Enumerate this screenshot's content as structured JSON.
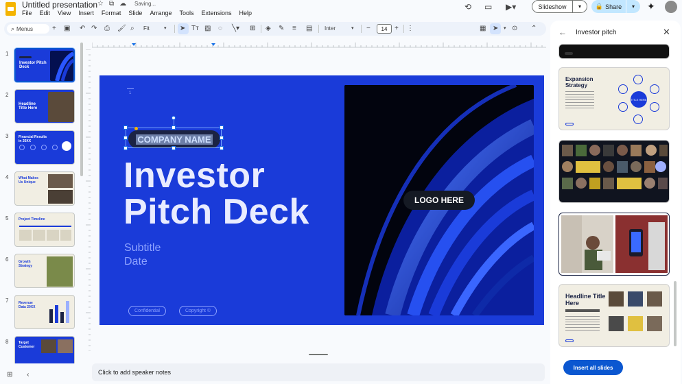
{
  "app": {
    "title": "Untitled presentation",
    "saving_status": "Saving...",
    "title_icons": [
      "☆",
      "⧉",
      "☁"
    ],
    "menu": [
      "File",
      "Edit",
      "View",
      "Insert",
      "Format",
      "Slide",
      "Arrange",
      "Tools",
      "Extensions",
      "Help"
    ]
  },
  "header": {
    "slideshow_label": "Slideshow",
    "share_label": "Share"
  },
  "toolbar": {
    "menus_label": "Menus",
    "zoom_label": "Fit",
    "font_label": "Inter",
    "font_size": "14"
  },
  "filmstrip": [
    {
      "num": "1",
      "title": "Investor Pitch Deck",
      "style": "blue"
    },
    {
      "num": "2",
      "title": "Headline Title Here",
      "style": "blue"
    },
    {
      "num": "3",
      "title": "Financial Results in 20XX",
      "style": "blue"
    },
    {
      "num": "4",
      "title": "What Makes Us Unique",
      "style": "cream"
    },
    {
      "num": "5",
      "title": "Project Timeline",
      "style": "cream"
    },
    {
      "num": "6",
      "title": "Growth Strategy",
      "style": "cream"
    },
    {
      "num": "7",
      "title": "Revenue Data 20XX",
      "style": "cream"
    },
    {
      "num": "8",
      "title": "Target Customer",
      "style": "blue"
    }
  ],
  "slide": {
    "number": "1",
    "company": "COMPANY NAME",
    "title_line1": "Investor",
    "title_line2": "Pitch Deck",
    "subtitle_line1": "Subtitle",
    "subtitle_line2": "Date",
    "confidential": "Confidential",
    "copyright": "Copyright ©",
    "logo": "LOGO HERE"
  },
  "notes": {
    "placeholder": "Click to add speaker notes"
  },
  "sidepanel": {
    "title": "Investor pitch",
    "cards": [
      {
        "title": "Expansion Strategy",
        "center": "TITLE HERE"
      },
      {
        "title": ""
      },
      {
        "title": ""
      },
      {
        "title": "Headline Title Here"
      }
    ],
    "insert_label": "Insert all slides"
  },
  "colors": {
    "slide_blue": "#1a3bd9",
    "accent": "#0b57d0",
    "share_bg": "#c2e7ff"
  }
}
